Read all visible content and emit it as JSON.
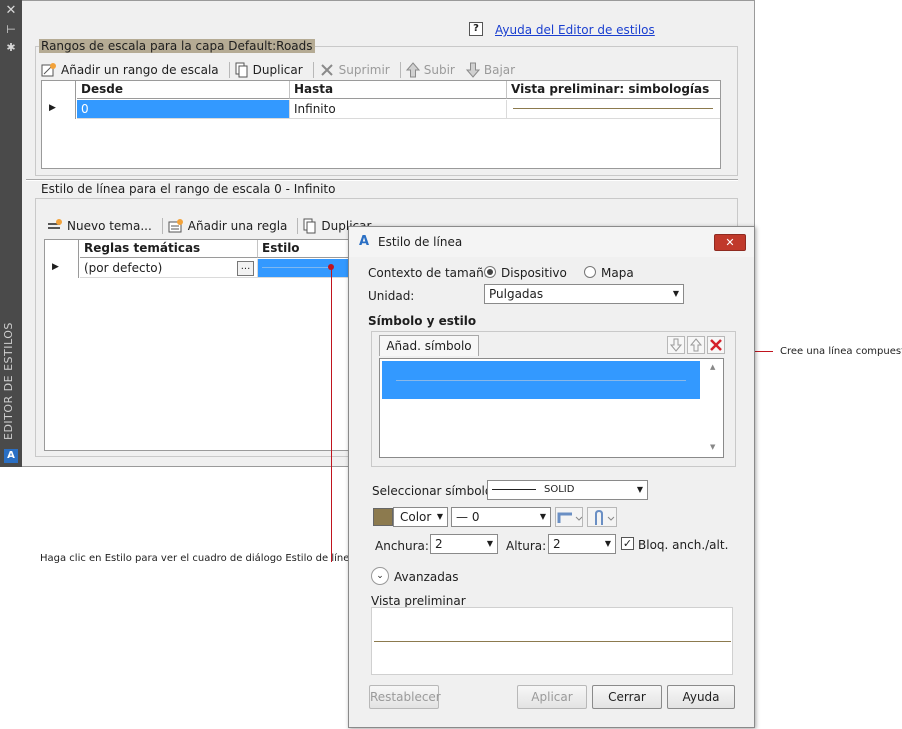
{
  "sidebar": {
    "title": "EDITOR DE ESTILOS",
    "icons": [
      "close-icon",
      "pin-icon",
      "settings-icon",
      "app-logo-icon"
    ]
  },
  "palette": {
    "help_link": "Ayuda del Editor de estilos",
    "scale_group": {
      "title": "Rangos de escala para la capa Default:Roads",
      "toolbar": {
        "add": "Añadir un rango de escala",
        "duplicate": "Duplicar",
        "delete": "Suprimir",
        "up": "Subir",
        "down": "Bajar"
      },
      "columns": [
        "Desde",
        "Hasta",
        "Vista preliminar: simbologías"
      ],
      "rows": [
        {
          "from": "0",
          "to": "Infinito"
        }
      ]
    },
    "line_group": {
      "title": "Estilo de línea para el rango de escala 0 - Infinito",
      "toolbar": {
        "new_theme": "Nuevo tema...",
        "add_rule": "Añadir una regla",
        "duplicate": "Duplicar"
      },
      "columns": [
        "Reglas temáticas",
        "Estilo"
      ],
      "rows": [
        {
          "rule": "(por defecto)",
          "ellipsis": "..."
        }
      ]
    }
  },
  "dialog": {
    "title": "Estilo de línea",
    "size_context_label": "Contexto de tamaño:",
    "size_context_options": [
      "Dispositivo",
      "Mapa"
    ],
    "size_context_selected": "Dispositivo",
    "unit_label": "Unidad:",
    "unit_value": "Pulgadas",
    "symbol_section": "Símbolo y estilo",
    "add_symbol_tab": "Añad. símbolo",
    "select_symbol_label": "Seleccionar símbolo:",
    "select_symbol_value": "SOLID",
    "color_label": "Color",
    "color_swatch": "#8c7a4e",
    "line_weight_value": "0",
    "width_label": "Anchura:",
    "width_value": "2",
    "height_label": "Altura:",
    "height_value": "2",
    "lock_label": "Bloq. anch./alt.",
    "lock_checked": true,
    "advanced_label": "Avanzadas",
    "preview_label": "Vista preliminar",
    "buttons": {
      "reset": "Restablecer",
      "apply": "Aplicar",
      "close": "Cerrar",
      "help": "Ayuda"
    }
  },
  "callouts": {
    "compound_line": "Cree una línea compuesta",
    "click_style": "Haga clic en Estilo para ver el cuadro de diálogo Estilo de línea"
  },
  "colors": {
    "selection": "#3399ff",
    "preview_line": "#8c7a4e",
    "callout_line": "#c0141e",
    "link": "#1a3fd0"
  }
}
